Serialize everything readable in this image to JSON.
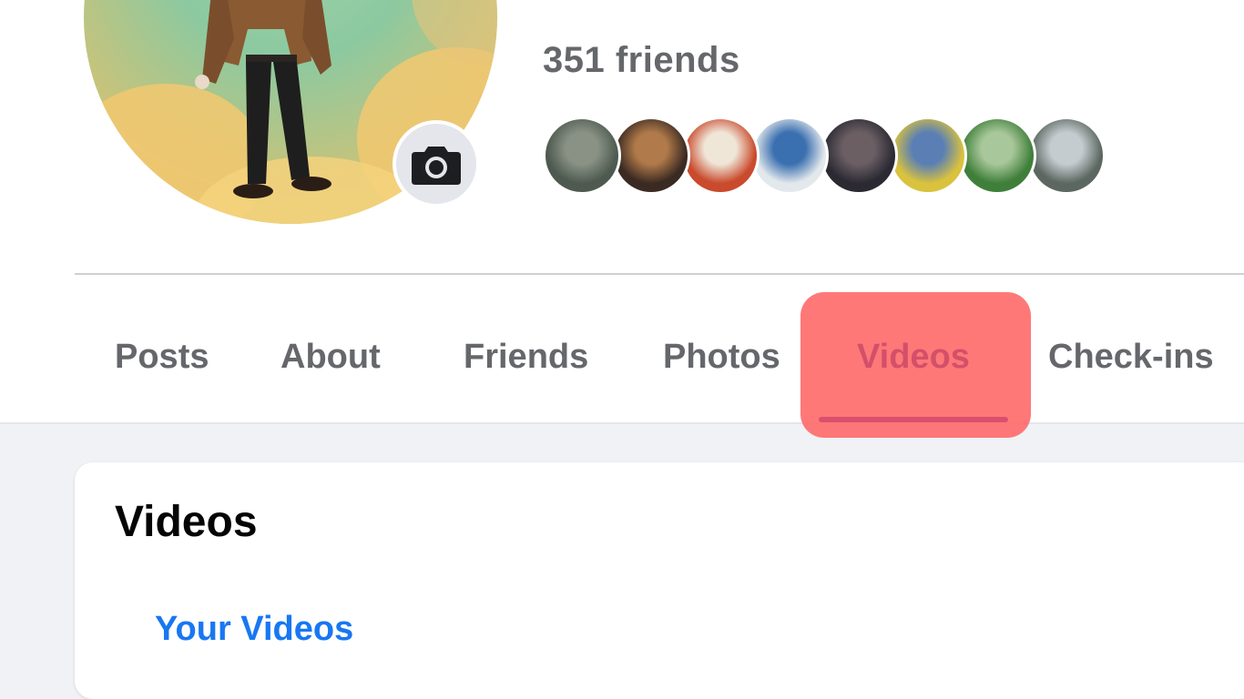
{
  "profile": {
    "friend_count_text": "351 friends",
    "camera_icon": "camera-icon"
  },
  "friends": [
    {
      "label": "friend-1",
      "colors": [
        "#4e5a50",
        "#8a9285"
      ]
    },
    {
      "label": "friend-2",
      "colors": [
        "#3b2a22",
        "#b07a4a"
      ]
    },
    {
      "label": "friend-3",
      "colors": [
        "#c94a2c",
        "#f0e6d8"
      ]
    },
    {
      "label": "friend-4",
      "colors": [
        "#e3e8ec",
        "#3a6fb0"
      ]
    },
    {
      "label": "friend-5",
      "colors": [
        "#2b2a33",
        "#6b5f64"
      ]
    },
    {
      "label": "friend-6",
      "colors": [
        "#d9c23e",
        "#5a7fb5"
      ]
    },
    {
      "label": "friend-7",
      "colors": [
        "#3f7f3a",
        "#a8c79a"
      ]
    },
    {
      "label": "friend-8",
      "colors": [
        "#5b6760",
        "#c5ccd0"
      ]
    }
  ],
  "tabs": [
    {
      "label": "Posts",
      "active": false
    },
    {
      "label": "About",
      "active": false
    },
    {
      "label": "Friends",
      "active": false
    },
    {
      "label": "Photos",
      "active": false
    },
    {
      "label": "Videos",
      "active": true
    },
    {
      "label": "Check-ins",
      "active": false
    }
  ],
  "videos_section": {
    "title": "Videos",
    "your_videos_link": "Your Videos"
  },
  "colors": {
    "accent": "#1877f2",
    "highlight": "#ff6d6d",
    "muted_text": "#65676b",
    "background": "#f0f2f5"
  }
}
